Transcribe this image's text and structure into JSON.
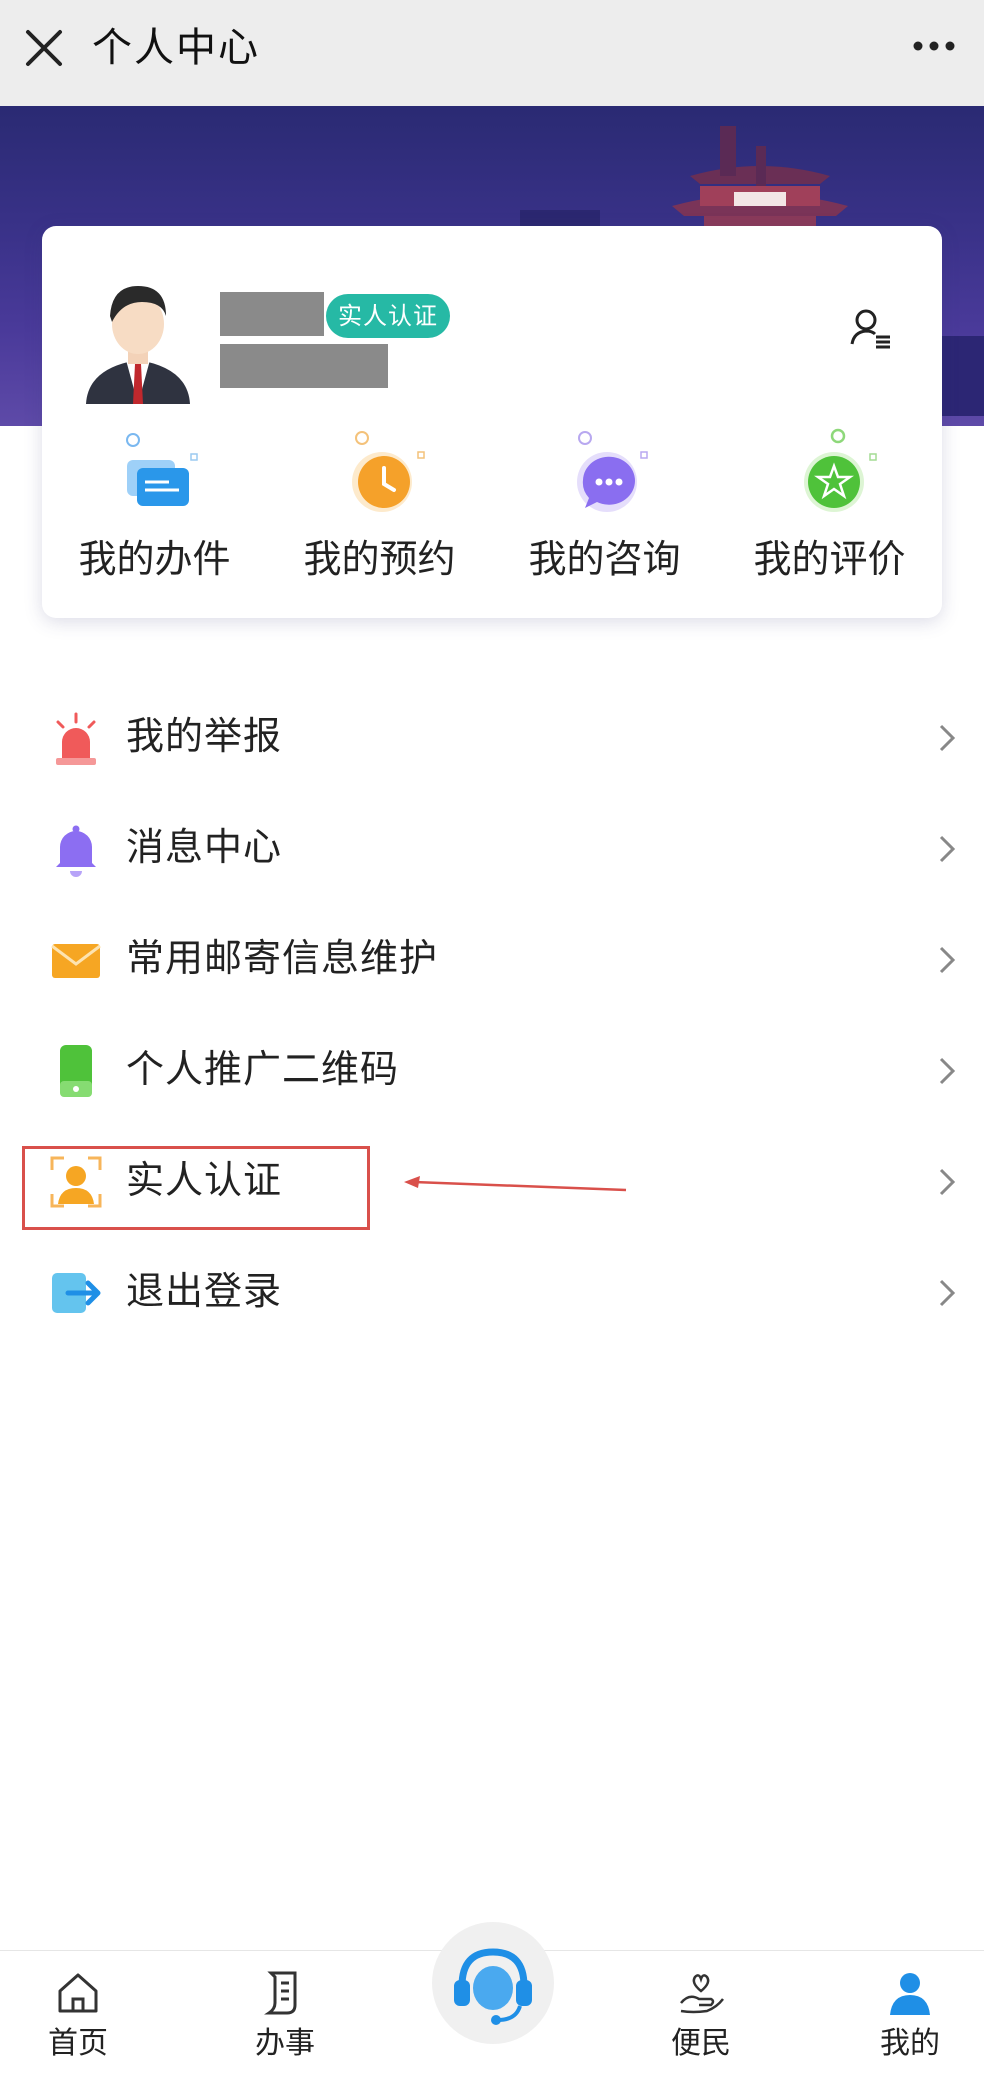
{
  "header": {
    "title": "个人中心"
  },
  "profile": {
    "verified_badge": "实人认证"
  },
  "quick_actions": [
    {
      "label": "我的办件",
      "icon": "documents-icon"
    },
    {
      "label": "我的预约",
      "icon": "clock-icon"
    },
    {
      "label": "我的咨询",
      "icon": "chat-icon"
    },
    {
      "label": "我的评价",
      "icon": "star-icon"
    }
  ],
  "menu": [
    {
      "label": "我的举报",
      "icon": "alarm-icon"
    },
    {
      "label": "消息中心",
      "icon": "bell-icon"
    },
    {
      "label": "常用邮寄信息维护",
      "icon": "envelope-icon"
    },
    {
      "label": "个人推广二维码",
      "icon": "phone-icon"
    },
    {
      "label": "实人认证",
      "icon": "face-id-icon"
    },
    {
      "label": "退出登录",
      "icon": "logout-icon"
    }
  ],
  "bottom_nav": [
    {
      "label": "首页",
      "icon": "home-icon"
    },
    {
      "label": "办事",
      "icon": "document-icon"
    },
    {
      "label": "便民",
      "icon": "hand-heart-icon"
    },
    {
      "label": "我的",
      "icon": "user-icon",
      "active": true
    }
  ],
  "colors": {
    "badge": "#26b9a5",
    "accent": "#1f8fe6",
    "highlight_box": "#d9504b"
  }
}
